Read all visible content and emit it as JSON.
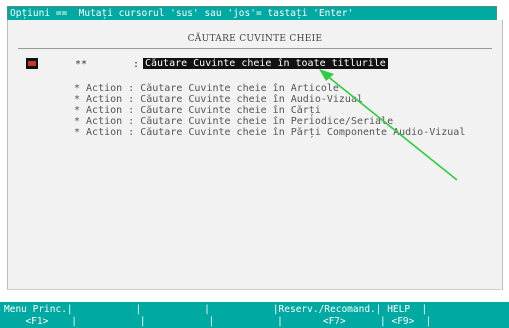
{
  "top_bar": {
    "hint": "Opțiuni ==  Mutați cursorul 'sus' sau 'jos'= tastați 'Enter'"
  },
  "main": {
    "title": "CĂUTARE CUVINTE CHEIE",
    "selected": {
      "marker": "**",
      "colon": ":",
      "label": "Căutare Cuvinte cheie în toate titlurile"
    },
    "options": [
      "* Action : Căutare Cuvinte cheie în Articole",
      "* Action : Căutare Cuvinte cheie în Audio-Vizual",
      "* Action : Căutare Cuvinte cheie în Cărți",
      "* Action : Căutare Cuvinte cheie în Periodice/Seriale",
      "* Action : Căutare Cuvinte cheie în Părți Componente Audio-Vizual"
    ]
  },
  "fkey_bar": {
    "line1": "Menu Princ.|           |           |           |Reserv./Recomand.| HELP  |",
    "line2": "  <F1>    |           |           |           |       <F7>      | <F9>  |"
  },
  "colors": {
    "bar": "#00a9a2",
    "annotation_arrow": "#2ecc40"
  }
}
